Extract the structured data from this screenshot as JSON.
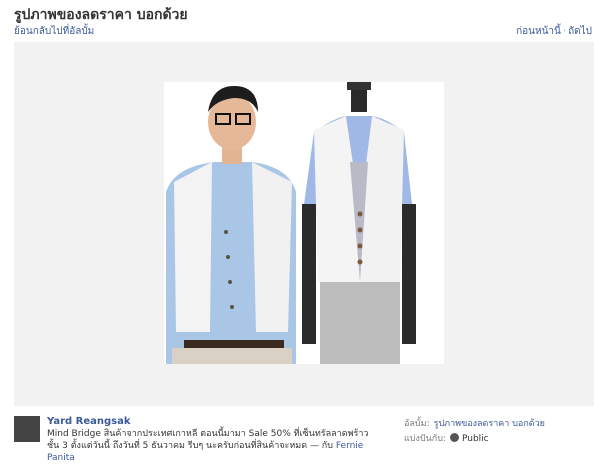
{
  "header": {
    "title": "รูปภาพของลดราคา บอกด้วย",
    "back_link": "ย้อนกลับไปที่อัลบั้ม",
    "prev": "ก่อนหน้านี้",
    "next": "ถัดไป"
  },
  "post": {
    "author": "Yard Reangsak",
    "caption": "Mind Bridge สินค้าจากประเทศเกาหลี ตอนนี้มามา Sale 50% ที่เซ็นทรัลลาดพร้าว ชั้น 3 ตั้งแต่วันนี้ ถึงวันที่ 5 ธันวาคม รีบๆ นะครับก่อนที่สินค้าจะหมด — กับ",
    "tagged": "Fernie Panita"
  },
  "meta": {
    "album_label": "อัลบั้ม:",
    "album_value": "รูปภาพของลดราคา บอกด้วย",
    "shared_label": "แบ่งปันกับ:",
    "shared_value": "Public"
  },
  "icons": {
    "privacy": "globe-icon"
  }
}
